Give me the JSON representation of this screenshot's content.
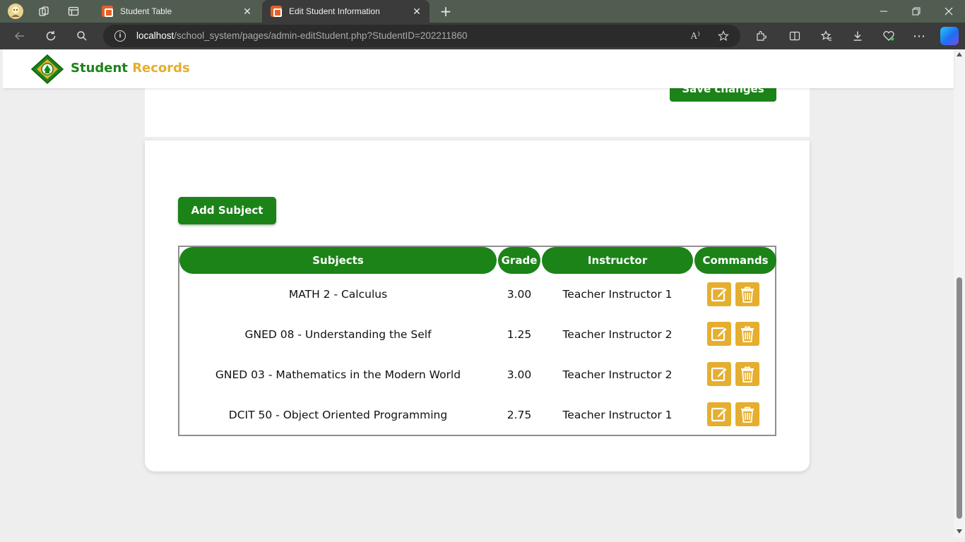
{
  "browser": {
    "tabs": [
      {
        "title": "Student Table",
        "active": false
      },
      {
        "title": "Edit Student Information",
        "active": true
      }
    ],
    "url_host": "localhost",
    "url_path": "/school_system/pages/admin-editStudent.php?StudentID=202211860",
    "read_aloud_glyph": "A⁾"
  },
  "nav": {
    "brand_part1": "Student",
    "brand_part2": "Records"
  },
  "form": {
    "save_label": "Save changes"
  },
  "subjects": {
    "add_label": "Add Subject",
    "columns": {
      "subjects": "Subjects",
      "grade": "Grade",
      "instructor": "Instructor",
      "commands": "Commands"
    },
    "rows": [
      {
        "subject": "MATH 2 - Calculus",
        "grade": "3.00",
        "instructor": "Teacher Instructor 1"
      },
      {
        "subject": "GNED 08 - Understanding the Self",
        "grade": "1.25",
        "instructor": "Teacher Instructor 2"
      },
      {
        "subject": "GNED 03 - Mathematics in the Modern World",
        "grade": "3.00",
        "instructor": "Teacher Instructor 2"
      },
      {
        "subject": "DCIT 50 - Object Oriented Programming",
        "grade": "2.75",
        "instructor": "Teacher Instructor 1"
      }
    ]
  },
  "colors": {
    "brand_green": "#1b8317",
    "brand_gold": "#e5ae2e",
    "page_bg": "#eeeeee"
  }
}
